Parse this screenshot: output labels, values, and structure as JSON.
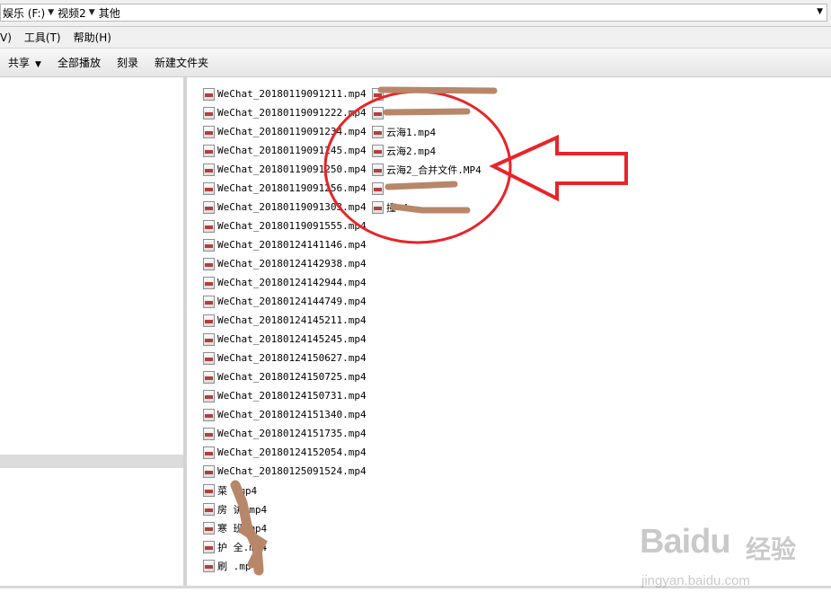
{
  "address": {
    "crumbs": [
      "娱乐 (F:)",
      "视频2",
      "其他"
    ]
  },
  "menu": [
    "V)",
    "工具(T)",
    "帮助(H)"
  ],
  "toolbar": {
    "share": "共享",
    "play_all": "全部播放",
    "burn": "刻录",
    "new_folder": "新建文件夹"
  },
  "files_col1": [
    "WeChat_20180119091211.mp4",
    "WeChat_20180119091222.mp4",
    "WeChat_20180119091234.mp4",
    "WeChat_20180119091245.mp4",
    "WeChat_20180119091250.mp4",
    "WeChat_20180119091256.mp4",
    "WeChat_20180119091303.mp4",
    "WeChat_20180119091555.mp4",
    "WeChat_20180124141146.mp4",
    "WeChat_20180124142938.mp4",
    "WeChat_20180124142944.mp4",
    "WeChat_20180124144749.mp4",
    "WeChat_20180124145211.mp4",
    "WeChat_20180124145245.mp4",
    "WeChat_20180124150627.mp4",
    "WeChat_20180124150725.mp4",
    "WeChat_20180124150731.mp4",
    "WeChat_20180124151340.mp4",
    "WeChat_20180124151735.mp4",
    "WeChat_20180124152054.mp4",
    "WeChat_20180125091524.mp4",
    "菜 .mp4",
    "房 讲.mp4",
    "寒 班.mp4",
    "护 全.mp4",
    "刷 .mp4"
  ],
  "files_col2": [
    "",
    "",
    "云海1.mp4",
    "云海2.mp4",
    "云海2_合并文件.MP4",
    "",
    "撞 4"
  ],
  "watermark": {
    "logo": "Baidu",
    "cn": "经验",
    "url": "jingyan.baidu.com"
  },
  "colors": {
    "annotation_red": "#e8242a",
    "scribble_brown": "#b8876a"
  }
}
